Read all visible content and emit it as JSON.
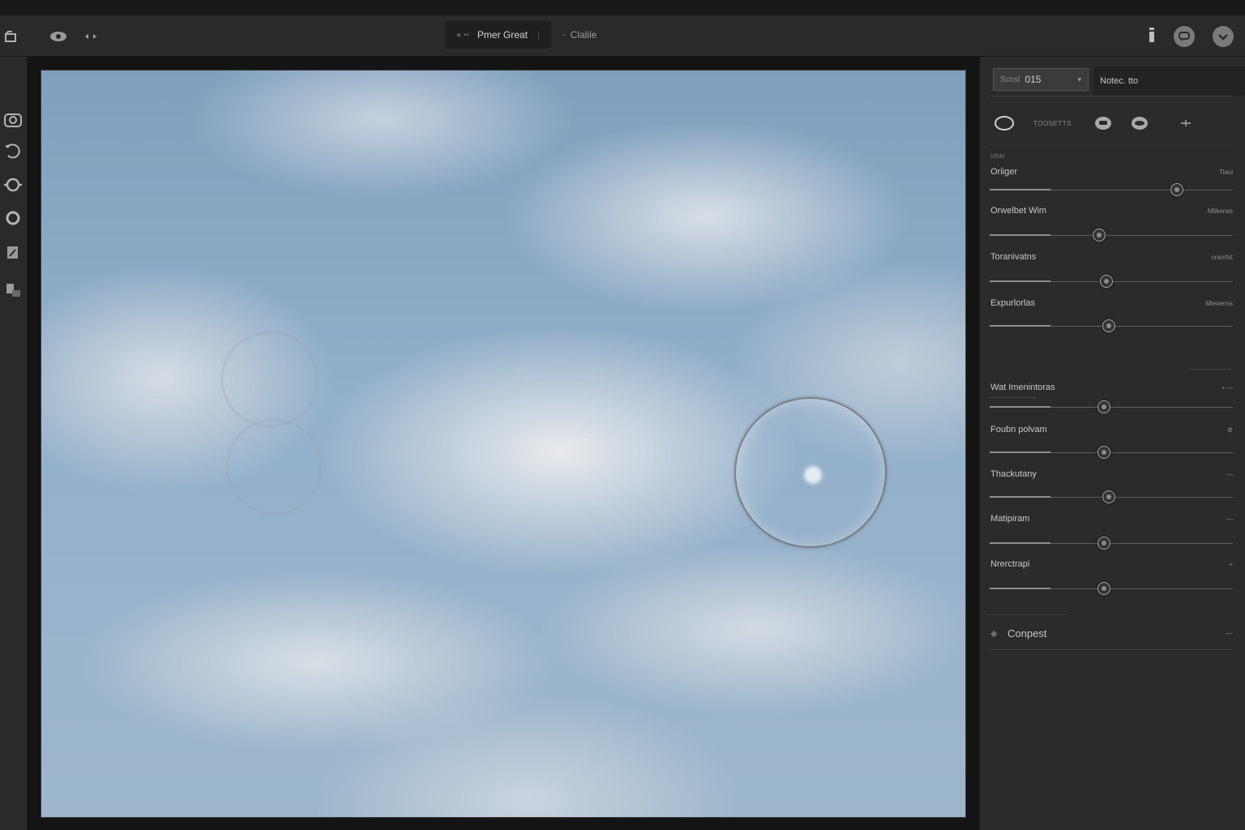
{
  "toolbar": {
    "tabs": [
      {
        "prefix": "● ▪▪",
        "label": "Pmer Great"
      },
      {
        "prefix": "▫",
        "label": "Clalile"
      }
    ]
  },
  "panel": {
    "preset_label": "Scnsl",
    "preset_value": "015",
    "notes_label": "Notec. tto",
    "icon_row_label": "TOOSETTS",
    "section_label": "Iritdo",
    "controls": [
      {
        "name": "Oriiger",
        "value": "Tiaol",
        "position": 0.77
      },
      {
        "name": "Orwelbet Wim",
        "value": "Mlikerws",
        "position": 0.45
      },
      {
        "name": "Toranivatns",
        "value": "cramfst",
        "position": 0.48
      },
      {
        "name": "Expurlorlas",
        "value": "Mlewerss",
        "position": 0.49
      },
      {
        "name": "Wat Imenintoras",
        "value": "• —",
        "position": 0.47
      },
      {
        "name": "Foubn polvam",
        "value": "⚙",
        "position": 0.47
      },
      {
        "name": "Thackutany",
        "value": "—",
        "position": 0.49
      },
      {
        "name": "Matipiram",
        "value": "—",
        "position": 0.47
      },
      {
        "name": "Nrerctrapi",
        "value": "+",
        "position": 0.47
      }
    ],
    "footer_button": "Conpest",
    "footer_value": "—"
  },
  "colors": {
    "toolbar_bg": "#2a2a2a",
    "panel_bg": "#2b2b2b",
    "canvas_bg": "#141414",
    "sky": "#8fadc8"
  },
  "icons": {
    "toolbar_left": [
      "crop-icon",
      "eye-icon",
      "arrows-icon"
    ],
    "toolbar_right": [
      "info-icon",
      "chat-icon",
      "chevron-down-icon"
    ],
    "rail": [
      "camera-icon",
      "rotate-icon",
      "target-icon",
      "circle-icon",
      "flag-icon",
      "layers-icon"
    ],
    "panel_tools": [
      "circle-select-icon",
      "mask-icon",
      "eye-icon",
      "plus-icon"
    ]
  }
}
